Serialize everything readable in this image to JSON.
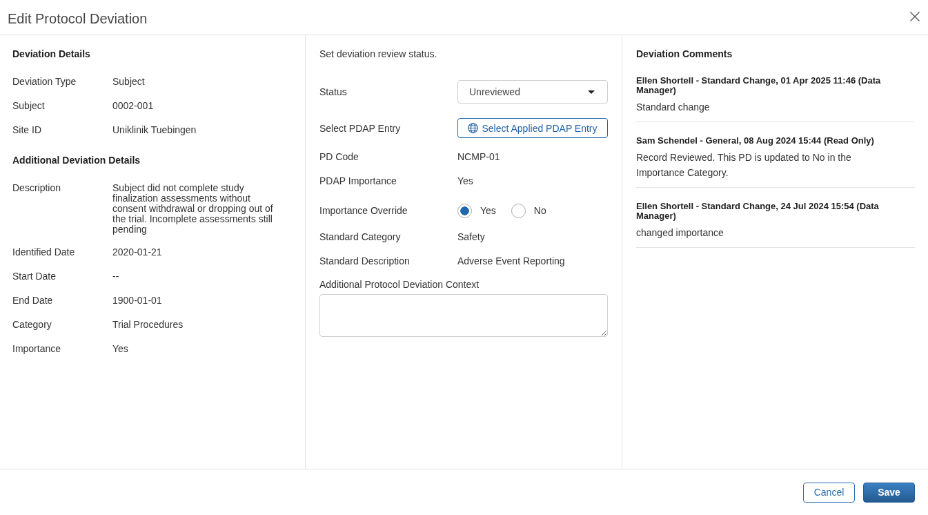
{
  "dialog": {
    "title": "Edit Protocol Deviation"
  },
  "deviation_details": {
    "heading": "Deviation Details",
    "fields": [
      {
        "label": "Deviation Type",
        "value": "Subject"
      },
      {
        "label": "Subject",
        "value": "0002-001"
      },
      {
        "label": "Site ID",
        "value": "Uniklinik Tuebingen"
      }
    ]
  },
  "additional_details": {
    "heading": "Additional Deviation Details",
    "fields": [
      {
        "label": "Description",
        "value": "Subject did not complete study finalization assessments without consent withdrawal or dropping out of the trial. Incomplete assessments still pending"
      },
      {
        "label": "Identified Date",
        "value": "2020-01-21"
      },
      {
        "label": "Start Date",
        "value": "--"
      },
      {
        "label": "End Date",
        "value": "1900-01-01"
      },
      {
        "label": "Category",
        "value": "Trial Procedures"
      },
      {
        "label": "Importance",
        "value": "Yes"
      }
    ]
  },
  "review": {
    "instruction": "Set deviation review status.",
    "fields": [
      {
        "kind": "select",
        "label": "Status",
        "value": "Unreviewed"
      },
      {
        "kind": "button",
        "label": "Select PDAP Entry",
        "button": "Select Applied PDAP Entry"
      },
      {
        "kind": "text",
        "label": "PD Code",
        "value": "NCMP-01"
      },
      {
        "kind": "text",
        "label": "PDAP Importance",
        "value": "Yes"
      },
      {
        "kind": "radio",
        "label": "Importance Override",
        "options": [
          {
            "label": "Yes",
            "selected": true
          },
          {
            "label": "No",
            "selected": false
          }
        ]
      },
      {
        "kind": "text",
        "label": "Standard Category",
        "value": "Safety"
      },
      {
        "kind": "text",
        "label": "Standard Description",
        "value": "Adverse Event Reporting"
      },
      {
        "kind": "textarea",
        "label": "Additional Protocol Deviation Context"
      }
    ]
  },
  "comments": {
    "heading": "Deviation Comments",
    "items": [
      {
        "author": "Ellen Shortell - Standard Change, 01 Apr 2025 11:46 (Data Manager)",
        "text": "Standard change"
      },
      {
        "author": "Sam Schendel - General, 08 Aug 2024 15:44 (Read Only)",
        "text": "Record Reviewed. This PD is updated to No in the Importance Category."
      },
      {
        "author": "Ellen Shortell - Standard Change, 24 Jul 2024 15:54 (Data Manager)",
        "text": "changed importance"
      }
    ]
  },
  "footer": {
    "buttons": [
      {
        "kind": "secondary",
        "label": "Cancel"
      },
      {
        "kind": "primary",
        "label": "Save"
      }
    ]
  }
}
